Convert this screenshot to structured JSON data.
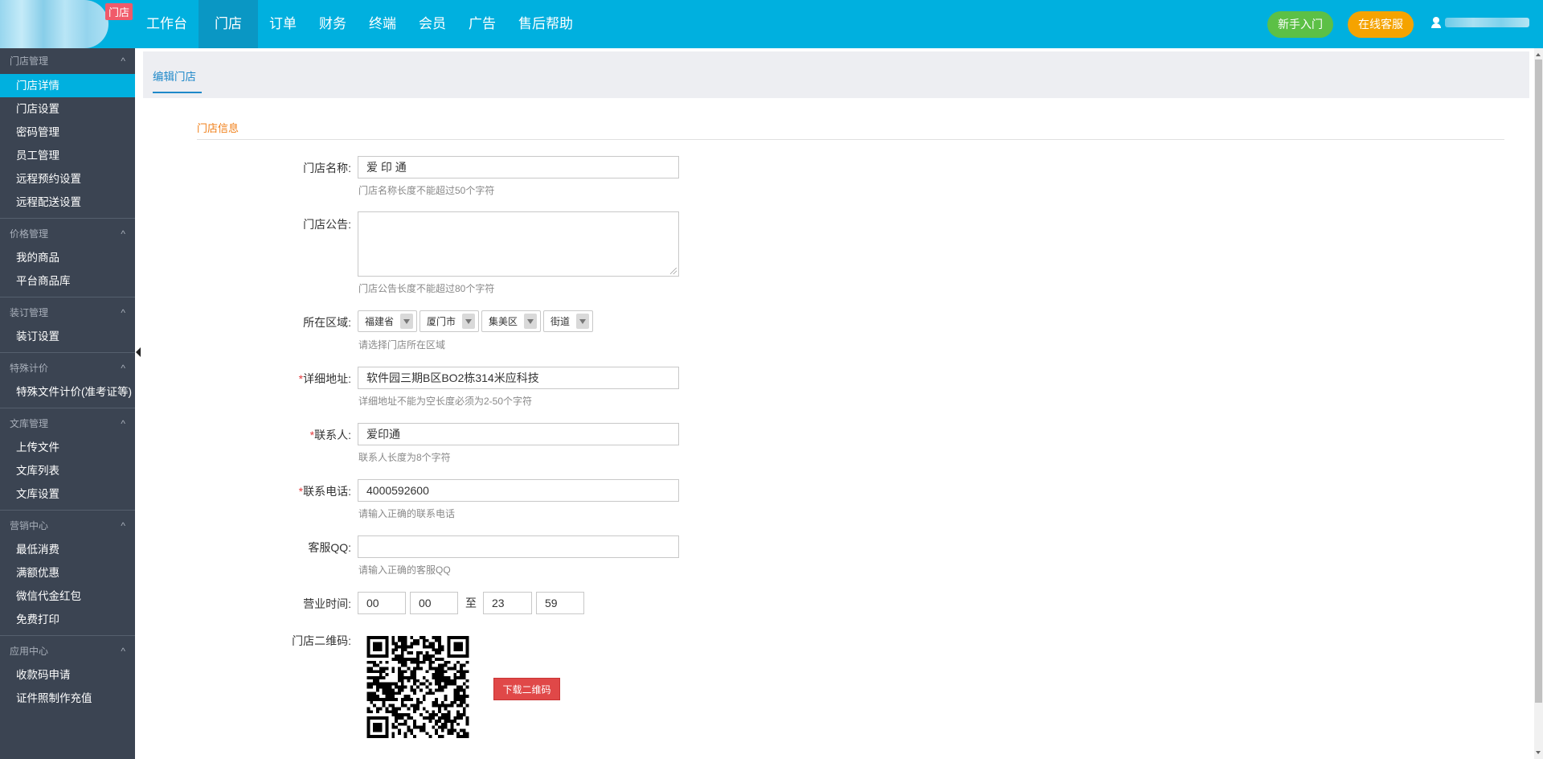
{
  "header": {
    "store_tag": "门店",
    "nav": [
      {
        "label": "工作台"
      },
      {
        "label": "门店"
      },
      {
        "label": "订单"
      },
      {
        "label": "财务"
      },
      {
        "label": "终端"
      },
      {
        "label": "会员"
      },
      {
        "label": "广告"
      },
      {
        "label": "售后帮助"
      }
    ],
    "guide_button": "新手入门",
    "service_button": "在线客服"
  },
  "sidebar": {
    "groups": [
      {
        "title": "门店管理",
        "items": [
          "门店详情",
          "门店设置",
          "密码管理",
          "员工管理",
          "远程预约设置",
          "远程配送设置"
        ]
      },
      {
        "title": "价格管理",
        "items": [
          "我的商品",
          "平台商品库"
        ]
      },
      {
        "title": "装订管理",
        "items": [
          "装订设置"
        ]
      },
      {
        "title": "特殊计价",
        "items": [
          "特殊文件计价(准考证等)"
        ]
      },
      {
        "title": "文库管理",
        "items": [
          "上传文件",
          "文库列表",
          "文库设置"
        ]
      },
      {
        "title": "营销中心",
        "items": [
          "最低消费",
          "满额优惠",
          "微信代金红包",
          "免费打印"
        ]
      },
      {
        "title": "应用中心",
        "items": [
          "收款码申请",
          "证件照制作充值"
        ]
      }
    ]
  },
  "tab": {
    "label": "编辑门店"
  },
  "section": {
    "title": "门店信息"
  },
  "form": {
    "name": {
      "label": "门店名称:",
      "value": "爱 印 通",
      "hint": "门店名称长度不能超过50个字符"
    },
    "notice": {
      "label": "门店公告:",
      "value": "",
      "hint": "门店公告长度不能超过80个字符"
    },
    "region": {
      "label": "所在区域:",
      "province": "福建省",
      "city": "厦门市",
      "district": "集美区",
      "street": "街道",
      "hint": "请选择门店所在区域"
    },
    "address": {
      "label": "详细地址:",
      "value": "软件园三期B区BO2栋314米应科技",
      "hint": "详细地址不能为空长度必须为2-50个字符"
    },
    "contact": {
      "label": "联系人:",
      "value": "爱印通",
      "hint": "联系人长度为8个字符"
    },
    "phone": {
      "label": "联系电话:",
      "value": "4000592600",
      "hint": "请输入正确的联系电话"
    },
    "qq": {
      "label": "客服QQ:",
      "value": "",
      "hint": "请输入正确的客服QQ"
    },
    "hours": {
      "label": "营业时间:",
      "start_hour": "00",
      "start_min": "00",
      "to": "至",
      "end_hour": "23",
      "end_min": "59"
    },
    "qrcode": {
      "label": "门店二维码:",
      "download_button": "下载二维码"
    },
    "required_mark": "*"
  }
}
